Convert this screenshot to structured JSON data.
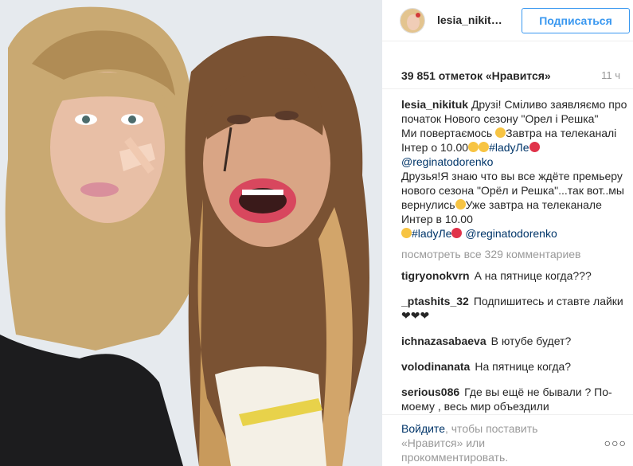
{
  "post": {
    "username": "lesia_nikit…",
    "follow_label": "Подписаться",
    "likes_text": "39 851 отметок «Нравится»",
    "time_ago": "11 ч"
  },
  "caption": {
    "author": "lesia_nikituk",
    "line1": "Друзі! Сміливо заявляємо про початок Нового сезону \"Орел і Решка\"",
    "line2a": "Ми повертаємось ",
    "line2b": "Завтра на телеканалі Інтер о 10.00",
    "hashtag1": "#ladyЛе",
    "mention1": "@reginatodorenko",
    "line3a": "Друзья!Я знаю что вы все ждёте премьеру нового сезона \"Орёл и Решка\"...так вот..мы вернулись",
    "line3b": "Уже завтра на телеканале Интер в 10.00",
    "hashtag2": "#ladyЛе",
    "mention2": "@reginatodorenko"
  },
  "view_more": "посмотреть все 329 комментариев",
  "comments": [
    {
      "user": "tigryonokvrn",
      "text": "А на пятнице когда???"
    },
    {
      "user": "_ptashits_32",
      "text": "Подпишитесь и ставте лайки ❤❤❤"
    },
    {
      "user": "ichnazasabaeva",
      "text": "В ютубе будет?"
    },
    {
      "user": "volodinanata",
      "text": "На пятнице когда?"
    },
    {
      "user": "serious086",
      "text": "Где вы ещё не бывали ? По-моему , весь мир объездили"
    }
  ],
  "footer": {
    "login_link": "Войдите",
    "login_rest": ", чтобы поставить «Нравится» или прокомментировать.",
    "more_options": "○○○"
  },
  "colors": {
    "accent": "#3897f0",
    "link": "#003569",
    "muted": "#999999"
  }
}
